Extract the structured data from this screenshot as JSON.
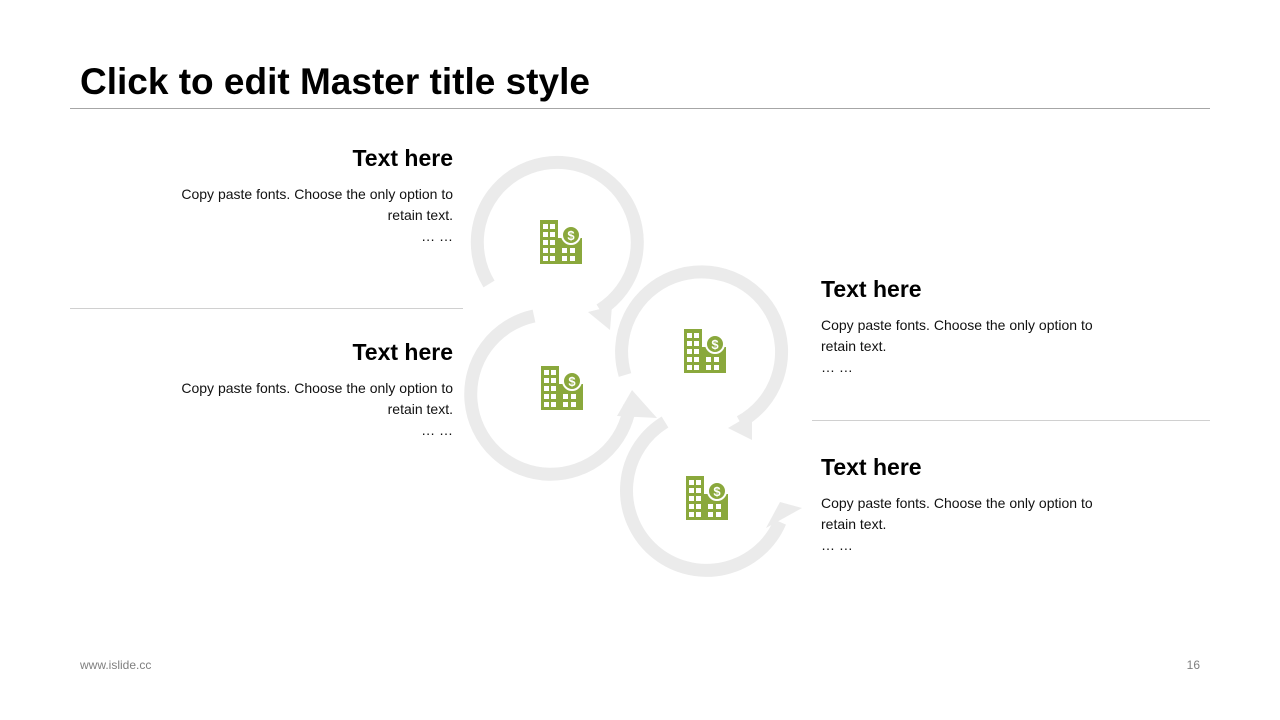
{
  "slide": {
    "title": "Click to edit Master title style",
    "footer_url": "www.islide.cc",
    "page_number": "16"
  },
  "blocks": [
    {
      "heading": "Text here",
      "body": "Copy paste fonts. Choose the only option to retain text.",
      "ellipsis": "… …"
    },
    {
      "heading": "Text here",
      "body": "Copy paste fonts. Choose the only option to retain text.",
      "ellipsis": "… …"
    },
    {
      "heading": "Text here",
      "body": "Copy paste fonts. Choose the only option to retain text.",
      "ellipsis": "… …"
    },
    {
      "heading": "Text here",
      "body": "Copy paste fonts. Choose the only option to retain text.",
      "ellipsis": "… …"
    }
  ],
  "diagram": {
    "icon": "building-dollar-icon",
    "colors": {
      "icon": "#8aa83c",
      "ring": "#ebebeb"
    }
  }
}
